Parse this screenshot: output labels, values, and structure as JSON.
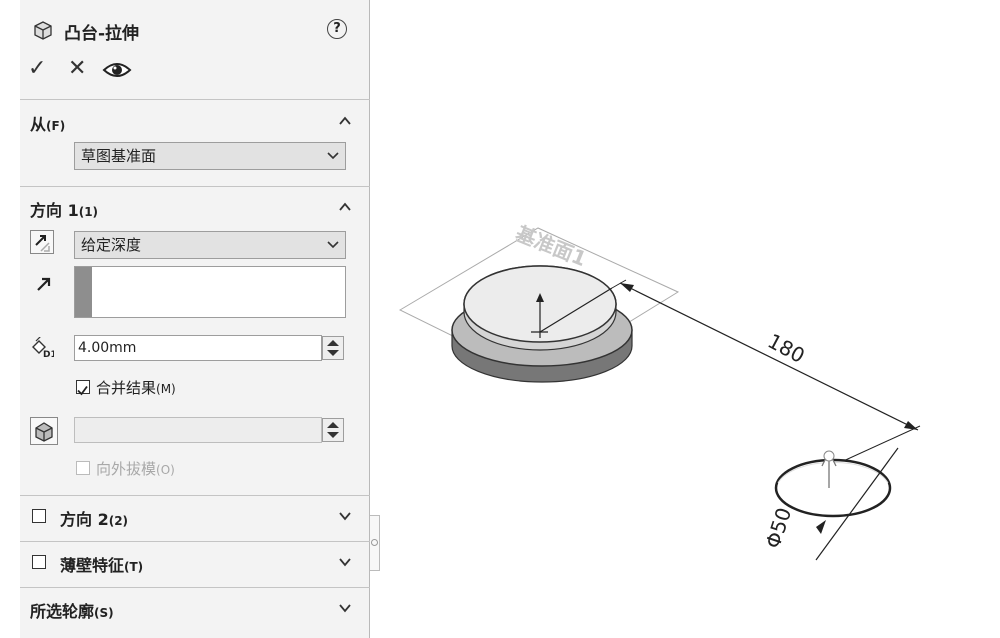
{
  "feature": {
    "title": "凸台-拉伸",
    "help_glyph": "?",
    "feature_icon": "boss-extrude-icon",
    "ok_glyph": "✓",
    "cancel_glyph": "✕"
  },
  "from_section": {
    "title": "从",
    "shortcut": "(F)",
    "start_condition": "草图基准面"
  },
  "direction1": {
    "title": "方向 1",
    "shortcut": "(1)",
    "end_condition": "给定深度",
    "depth": "4.00mm",
    "merge_label": "合并结果",
    "merge_shortcut": "(M)",
    "merge_checked": true,
    "draft_outward_label": "向外拔模",
    "draft_outward_shortcut": "(O)",
    "draft_outward_enabled": false
  },
  "direction2": {
    "title": "方向 2",
    "shortcut": "(2)"
  },
  "thin_feature": {
    "title": "薄壁特征",
    "shortcut": "(T)"
  },
  "selected_contours": {
    "title": "所选轮廓",
    "shortcut": "(S)"
  },
  "viewport": {
    "plane_label": "基准面1",
    "dimension_distance": "180",
    "dimension_diameter": "Φ50"
  }
}
